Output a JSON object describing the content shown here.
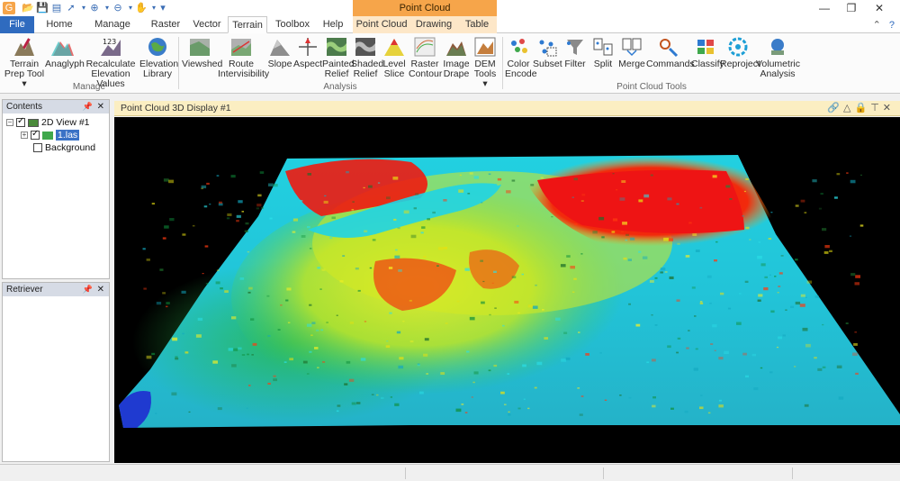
{
  "title_bar": {
    "context_group": "Point Cloud",
    "window_controls": [
      "minimize-icon",
      "restore-icon",
      "close-icon"
    ]
  },
  "tabs": [
    "File",
    "Home",
    "Manage Data",
    "Raster",
    "Vector",
    "Terrain",
    "Toolbox",
    "Help",
    "Point Cloud",
    "Drawing",
    "Table"
  ],
  "active_tab": "Terrain",
  "ribbon": {
    "manage": {
      "label": "Manage",
      "buttons": [
        "Terrain\nPrep Tool ▾",
        "Anaglyph",
        "Recalculate\nElevation Values",
        "Elevation\nLibrary"
      ]
    },
    "analysis": {
      "label": "Analysis",
      "buttons": [
        "Viewshed",
        "Route\nIntervisibility",
        "Slope",
        "Aspect",
        "Painted\nRelief",
        "Shaded\nRelief",
        "Level\nSlice",
        "Raster\nContour",
        "Image\nDrape",
        "DEM\nTools ▾"
      ]
    },
    "point_cloud_tools": {
      "label": "Point Cloud Tools",
      "buttons": [
        "Color\nEncode",
        "Subset",
        "Filter",
        "Split",
        "Merge",
        "Commands",
        "Classify",
        "Reproject",
        "Volumetric\nAnalysis"
      ]
    }
  },
  "contents_panel": {
    "title": "Contents",
    "items": [
      "2D View #1",
      "1.las",
      "Background"
    ]
  },
  "retriever_panel": {
    "title": "Retriever"
  },
  "document": {
    "title": "Point Cloud 3D Display #1"
  },
  "accent_colors": {
    "file_tab": "#2f6bbf",
    "context_tab": "#f6a54a",
    "doc_header": "#fbeec2"
  }
}
